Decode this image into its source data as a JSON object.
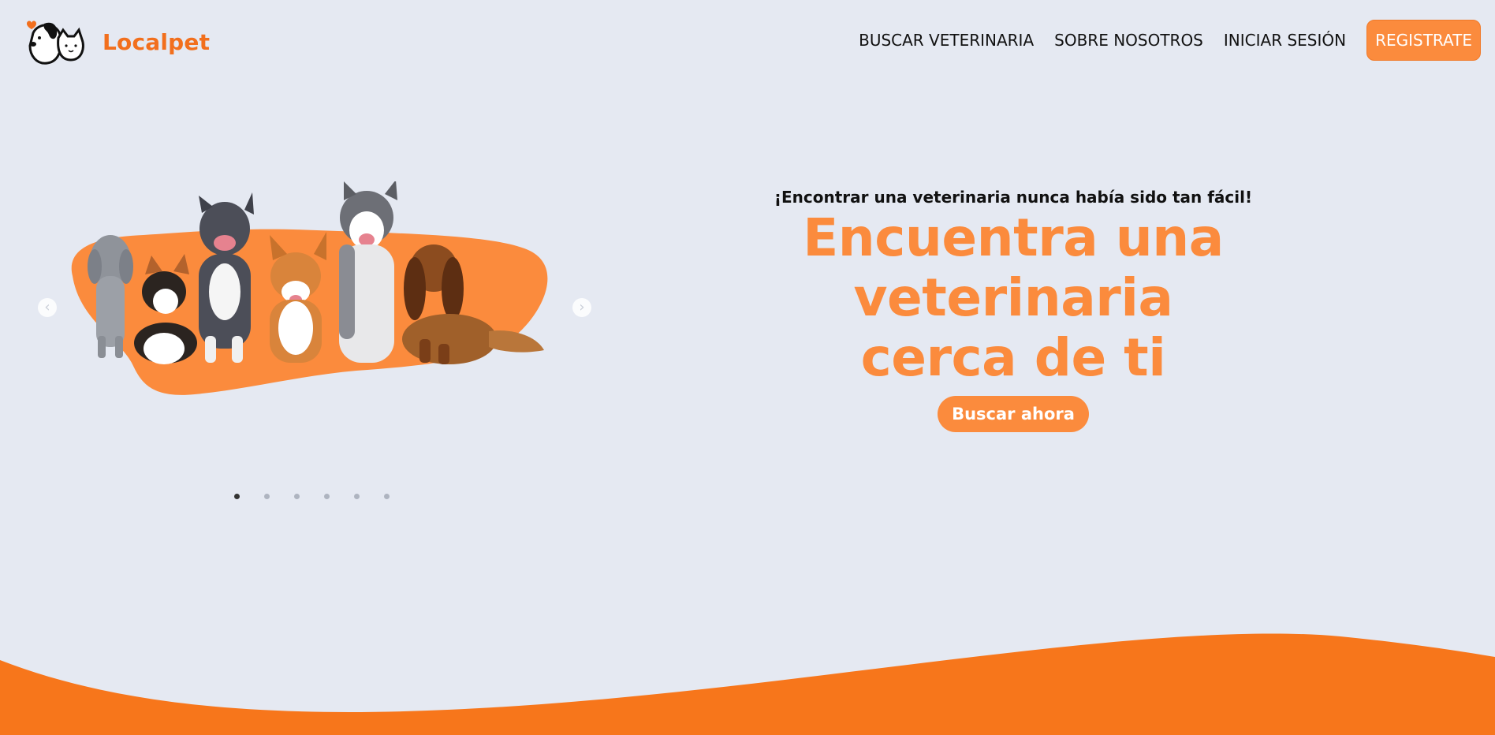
{
  "header": {
    "brand": "Localpet",
    "nav": {
      "find_vet": "BUSCAR VETERINARIA",
      "about": "SOBRE NOSOTROS",
      "login": "INICIAR SESIÓN",
      "register": "REGISTRATE"
    }
  },
  "carousel": {
    "image_subject": "group of seven dogs on orange blob",
    "prev_icon": "chevron-left-icon",
    "next_icon": "chevron-right-icon",
    "slide_count": 6,
    "active_slide": 1
  },
  "hero": {
    "subtitle": "¡Encontrar una veterinaria nunca había sido tan fácil!",
    "title_line1": "Encuentra una veterinaria",
    "title_line2": "cerca de ti",
    "cta": "Buscar ahora"
  },
  "colors": {
    "background": "#e5e9f2",
    "accent": "#fb8b3d",
    "brand": "#f26f1d",
    "wave": "#f7761b"
  }
}
